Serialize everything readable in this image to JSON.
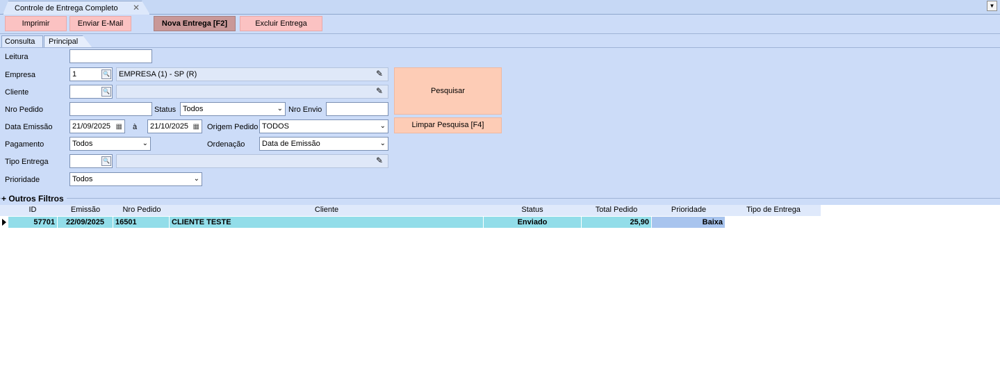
{
  "window": {
    "tab_title": "Controle de Entrega Completo"
  },
  "toolbar": {
    "print_label": "Imprimir",
    "email_label": "Enviar E-Mail",
    "new_label": "Nova Entrega [F2]",
    "delete_label": "Excluir Entrega"
  },
  "subtabs": {
    "consulta": "Consulta",
    "principal": "Principal"
  },
  "form": {
    "leitura_label": "Leitura",
    "leitura_value": "",
    "empresa_label": "Empresa",
    "empresa_code": "1",
    "empresa_name": "EMPRESA (1) - SP (R)",
    "cliente_label": "Cliente",
    "cliente_code": "",
    "cliente_name": "",
    "nro_pedido_label": "Nro Pedido",
    "nro_pedido_value": "",
    "status_label": "Status",
    "status_value": "Todos",
    "nro_envio_label": "Nro Envio",
    "nro_envio_value": "",
    "data_emissao_label": "Data Emissão",
    "date_from": "21/09/2025",
    "date_sep": "à",
    "date_to": "21/10/2025",
    "origem_label": "Origem Pedido",
    "origem_value": "TODOS",
    "pagamento_label": "Pagamento",
    "pagamento_value": "Todos",
    "ordenacao_label": "Ordenação",
    "ordenacao_value": "Data de Emissão",
    "tipo_entrega_label": "Tipo Entrega",
    "tipo_entrega_code": "",
    "tipo_entrega_name": "",
    "prioridade_label": "Prioridade",
    "prioridade_value": "Todos",
    "search_label": "Pesquisar",
    "clear_label": "Limpar Pesquisa [F4]",
    "outros_filtros_label": "+ Outros Filtros"
  },
  "grid": {
    "columns": [
      "ID",
      "Emissão",
      "Nro Pedido",
      "Cliente",
      "Status",
      "Total Pedido",
      "Prioridade",
      "Tipo de Entrega"
    ],
    "rows": [
      {
        "id": "57701",
        "emissao": "22/09/2025",
        "nro_pedido": "16501",
        "cliente": "CLIENTE TESTE",
        "status": "Enviado",
        "total": "25,90",
        "prioridade": "Baixa",
        "tipo_entrega": ""
      }
    ]
  },
  "colors": {
    "panel_bg": "#ccdcf8",
    "button_bg": "#fbc2c2",
    "primary_button_bg": "#c99898",
    "search_button_bg": "#fdccb6",
    "row_highlight": "#92dde9",
    "priority_cell": "#a8c4ee"
  }
}
